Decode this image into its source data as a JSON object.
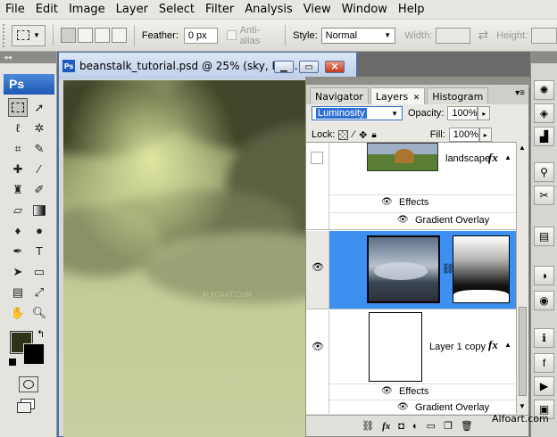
{
  "menu": [
    "File",
    "Edit",
    "Image",
    "Layer",
    "Select",
    "Filter",
    "Analysis",
    "View",
    "Window",
    "Help"
  ],
  "options": {
    "feather_label": "Feather:",
    "feather_value": "0 px",
    "antialias_label": "Anti-alias",
    "style_label": "Style:",
    "style_value": "Normal",
    "width_label": "Width:",
    "height_label": "Height:"
  },
  "toolbox": {
    "logo": "Ps"
  },
  "document": {
    "title": "beanstalk_tutorial.psd @ 25% (sky, RG...",
    "watermark": "ALFOART.COM"
  },
  "layers_panel": {
    "tabs": [
      "Navigator",
      "Layers",
      "Histogram"
    ],
    "active_tab": "Layers",
    "blend_mode": "Luminosity",
    "opacity_label": "Opacity:",
    "opacity_value": "100%",
    "lock_label": "Lock:",
    "fill_label": "Fill:",
    "fill_value": "100%",
    "layers": [
      {
        "name": "landscape",
        "fx": "fx",
        "effects_label": "Effects",
        "effect": "Gradient Overlay"
      },
      {
        "name": "",
        "fx": ""
      },
      {
        "name": "Layer 1 copy",
        "fx": "fx",
        "effects_label": "Effects",
        "effect": "Gradient Overlay"
      }
    ]
  },
  "site_watermark": "Alfoart.com",
  "colors": {
    "selection": "#3d8ff0",
    "foreground": "#2d3317",
    "background": "#000000",
    "sky_light": "#c8cf9f",
    "sky_dark": "#4e5536"
  }
}
